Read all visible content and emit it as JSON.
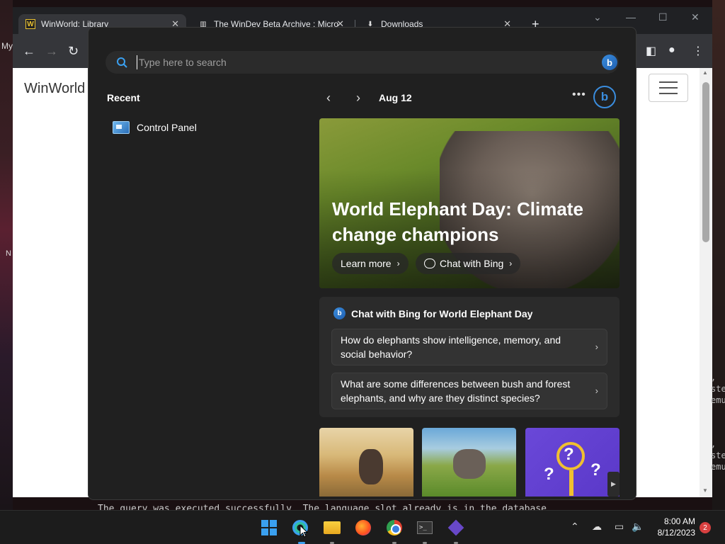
{
  "desktop": {
    "left_text": "My",
    "left_text2": "N",
    "console_line": "The query was executed successfully. The language slot already is in the database.",
    "right_term_lines": [
      ",",
      "ste",
      "emu",
      ",",
      "ste",
      "emu"
    ]
  },
  "browser": {
    "tabs": [
      {
        "title": "WinWorld: Library",
        "favicon": "winworld-icon"
      },
      {
        "title": "The WinDev Beta Archive : Micro",
        "favicon": "archive-icon"
      },
      {
        "title": "Downloads",
        "favicon": "download-icon"
      }
    ],
    "page": {
      "brand": "WinWorld"
    }
  },
  "search": {
    "placeholder": "Type here to search",
    "recent_title": "Recent",
    "recent_items": [
      {
        "label": "Control Panel",
        "icon": "control-panel-icon"
      }
    ],
    "date": "Aug 12",
    "hero": {
      "title": "World Elephant Day: Climate change champions",
      "learn_more": "Learn more",
      "chat_bing": "Chat with Bing"
    },
    "chat_card": {
      "heading": "Chat with Bing for World Elephant Day",
      "questions": [
        "How do elephants show intelligence, memory, and social behavior?",
        "What are some differences between bush and forest elephants, and why are they distinct species?"
      ]
    }
  },
  "taskbar": {
    "time": "8:00 AM",
    "date": "8/12/2023",
    "notifications": "2",
    "apps": [
      "start-icon",
      "search-icon",
      "file-explorer-icon",
      "firefox-icon",
      "chrome-icon",
      "terminal-icon",
      "visual-studio-icon"
    ]
  },
  "colors": {
    "accent": "#3aa0f0",
    "bing": "#3a8dde",
    "flyout_bg": "#202020"
  }
}
